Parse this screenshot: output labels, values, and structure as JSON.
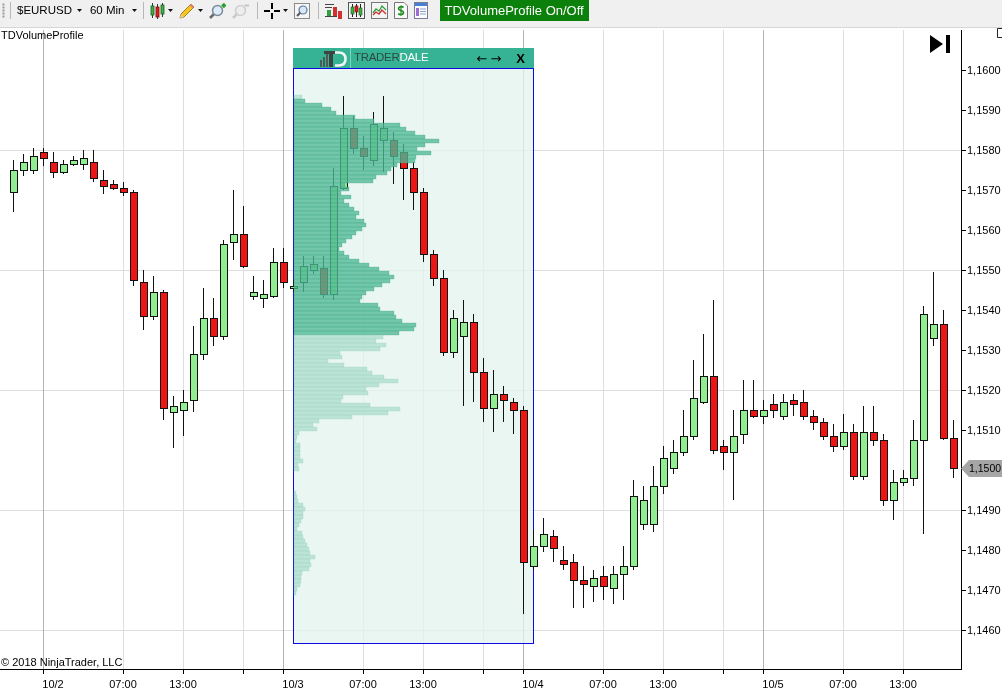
{
  "toolbar": {
    "instrument": {
      "label": "$EURUSD"
    },
    "interval": {
      "label": "60 Min"
    },
    "tools": [
      {
        "kind": "candles",
        "menu": true,
        "disabled": false
      },
      {
        "kind": "pencil",
        "menu": true,
        "disabled": false
      },
      {
        "kind": "zoom_in",
        "menu": false,
        "disabled": false
      },
      {
        "kind": "zoom_out",
        "menu": false,
        "disabled": true
      },
      {
        "kind": "separator"
      },
      {
        "kind": "crosshair",
        "menu": true,
        "disabled": false
      },
      {
        "kind": "zoom_box",
        "menu": false,
        "disabled": false
      },
      {
        "kind": "separator"
      },
      {
        "kind": "data_series",
        "menu": false,
        "disabled": false
      },
      {
        "kind": "chart_style",
        "menu": false,
        "disabled": false
      },
      {
        "kind": "line_chart",
        "menu": false,
        "disabled": false
      },
      {
        "kind": "dollar",
        "menu": false,
        "disabled": false
      },
      {
        "kind": "properties",
        "menu": false,
        "disabled": false
      }
    ],
    "indicator_toggle": {
      "label": "TDVolumeProfile On/Off",
      "on": true
    }
  },
  "chart": {
    "indicator_label": "TDVolumeProfile",
    "volume_profile": {
      "brand": [
        {
          "text": "TRADER",
          "kind": "dark"
        },
        {
          "text": "DALE",
          "kind": "light"
        }
      ],
      "nav": [
        "←",
        "→"
      ],
      "close": "X"
    },
    "price_axis": [
      "1,1600",
      "1,1590",
      "1,1580",
      "1,1570",
      "1,1560",
      "1,1550",
      "1,1540",
      "1,1530",
      "1,1520",
      "1,1510",
      "1,1490",
      "1,1480",
      "1,1470",
      "1,1460"
    ],
    "last_price_label": "1,1500",
    "copyright": "© 2018 NinjaTrader, LLC",
    "time_axis": [
      "10/2",
      "07:00",
      "13:00",
      "10/3",
      "07:00",
      "13:00",
      "10/4",
      "07:00",
      "13:00",
      "10/5",
      "07:00",
      "13:00"
    ]
  }
}
